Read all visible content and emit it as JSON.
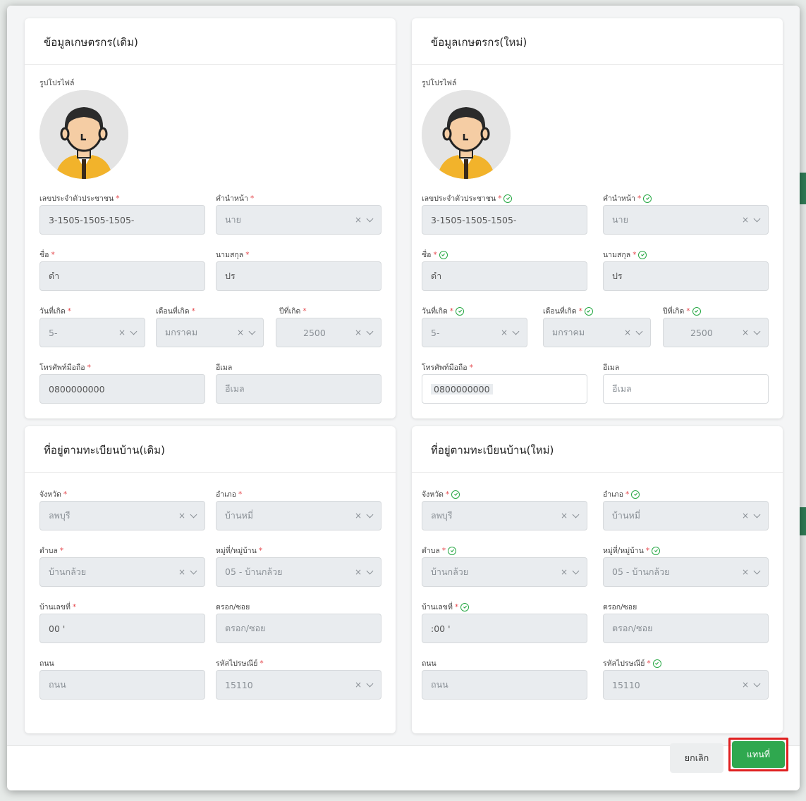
{
  "old_profile": {
    "title": "ข้อมูลเกษตรกร(เดิม)",
    "profile_label": "รูปโปรไฟล์",
    "fields": {
      "id_label": "เลขประจำตัวประชาชน",
      "id_value": "3-1505-1505-1505-",
      "prefix_label": "คำนำหน้า",
      "prefix_value": "นาย",
      "first_label": "ชื่อ",
      "first_value": "ดำ",
      "last_label": "นามสกุล",
      "last_value": "ปร",
      "day_label": "วันที่เกิด",
      "day_value": "5-",
      "month_label": "เดือนที่เกิด",
      "month_value": "มกราคม",
      "year_label": "ปีที่เกิด",
      "year_value": "2500",
      "phone_label": "โทรศัพท์มือถือ",
      "phone_value": "0800000000",
      "email_label": "อีเมล",
      "email_placeholder": "อีเมล"
    }
  },
  "new_profile": {
    "title": "ข้อมูลเกษตรกร(ใหม่)",
    "profile_label": "รูปโปรไฟล์",
    "fields": {
      "id_label": "เลขประจำตัวประชาชน",
      "id_value": "3-1505-1505-1505-",
      "prefix_label": "คำนำหน้า",
      "prefix_value": "นาย",
      "first_label": "ชื่อ",
      "first_value": "ดำ",
      "last_label": "นามสกุล",
      "last_value": "ปร",
      "day_label": "วันที่เกิด",
      "day_value": "5-",
      "month_label": "เดือนที่เกิด",
      "month_value": "มกราคม",
      "year_label": "ปีที่เกิด",
      "year_value": "2500",
      "phone_label": "โทรศัพท์มือถือ",
      "phone_value": "0800000000",
      "email_label": "อีเมล",
      "email_placeholder": "อีเมล"
    }
  },
  "old_address": {
    "title": "ที่อยู่ตามทะเบียนบ้าน(เดิม)",
    "fields": {
      "province_label": "จังหวัด",
      "province_value": "ลพบุรี",
      "district_label": "อำเภอ",
      "district_value": "บ้านหมี่",
      "subdistrict_label": "ตำบล",
      "subdistrict_value": "บ้านกล้วย",
      "village_label": "หมู่ที่/หมู่บ้าน",
      "village_value": "05 - บ้านกล้วย",
      "house_label": "บ้านเลขที่",
      "house_value": "00 '",
      "alley_label": "ตรอก/ซอย",
      "alley_placeholder": "ตรอก/ซอย",
      "road_label": "ถนน",
      "road_placeholder": "ถนน",
      "postal_label": "รหัสไปรษณีย์",
      "postal_value": "15110"
    }
  },
  "new_address": {
    "title": "ที่อยู่ตามทะเบียนบ้าน(ใหม่)",
    "fields": {
      "province_label": "จังหวัด",
      "province_value": "ลพบุรี",
      "district_label": "อำเภอ",
      "district_value": "บ้านหมี่",
      "subdistrict_label": "ตำบล",
      "subdistrict_value": "บ้านกล้วย",
      "village_label": "หมู่ที่/หมู่บ้าน",
      "village_value": "05 - บ้านกล้วย",
      "house_label": "บ้านเลขที่",
      "house_value": ":00 '",
      "alley_label": "ตรอก/ซอย",
      "alley_placeholder": "ตรอก/ซอย",
      "road_label": "ถนน",
      "road_placeholder": "ถนน",
      "postal_label": "รหัสไปรษณีย์",
      "postal_value": "15110"
    }
  },
  "common": {
    "required_mark": "*",
    "clear_glyph": "×"
  },
  "footer": {
    "cancel_label": "ยกเลิก",
    "replace_label": "แทนที่"
  },
  "colors": {
    "accent_green": "#2fa84f",
    "required_red": "#e5484d",
    "highlight_red": "#e02020",
    "valid_green": "#27a844"
  },
  "icons": {
    "avatar": "farmer-avatar-icon",
    "clear": "clear-x-icon",
    "dropdown": "chevron-down-icon",
    "valid": "check-circle-icon"
  }
}
